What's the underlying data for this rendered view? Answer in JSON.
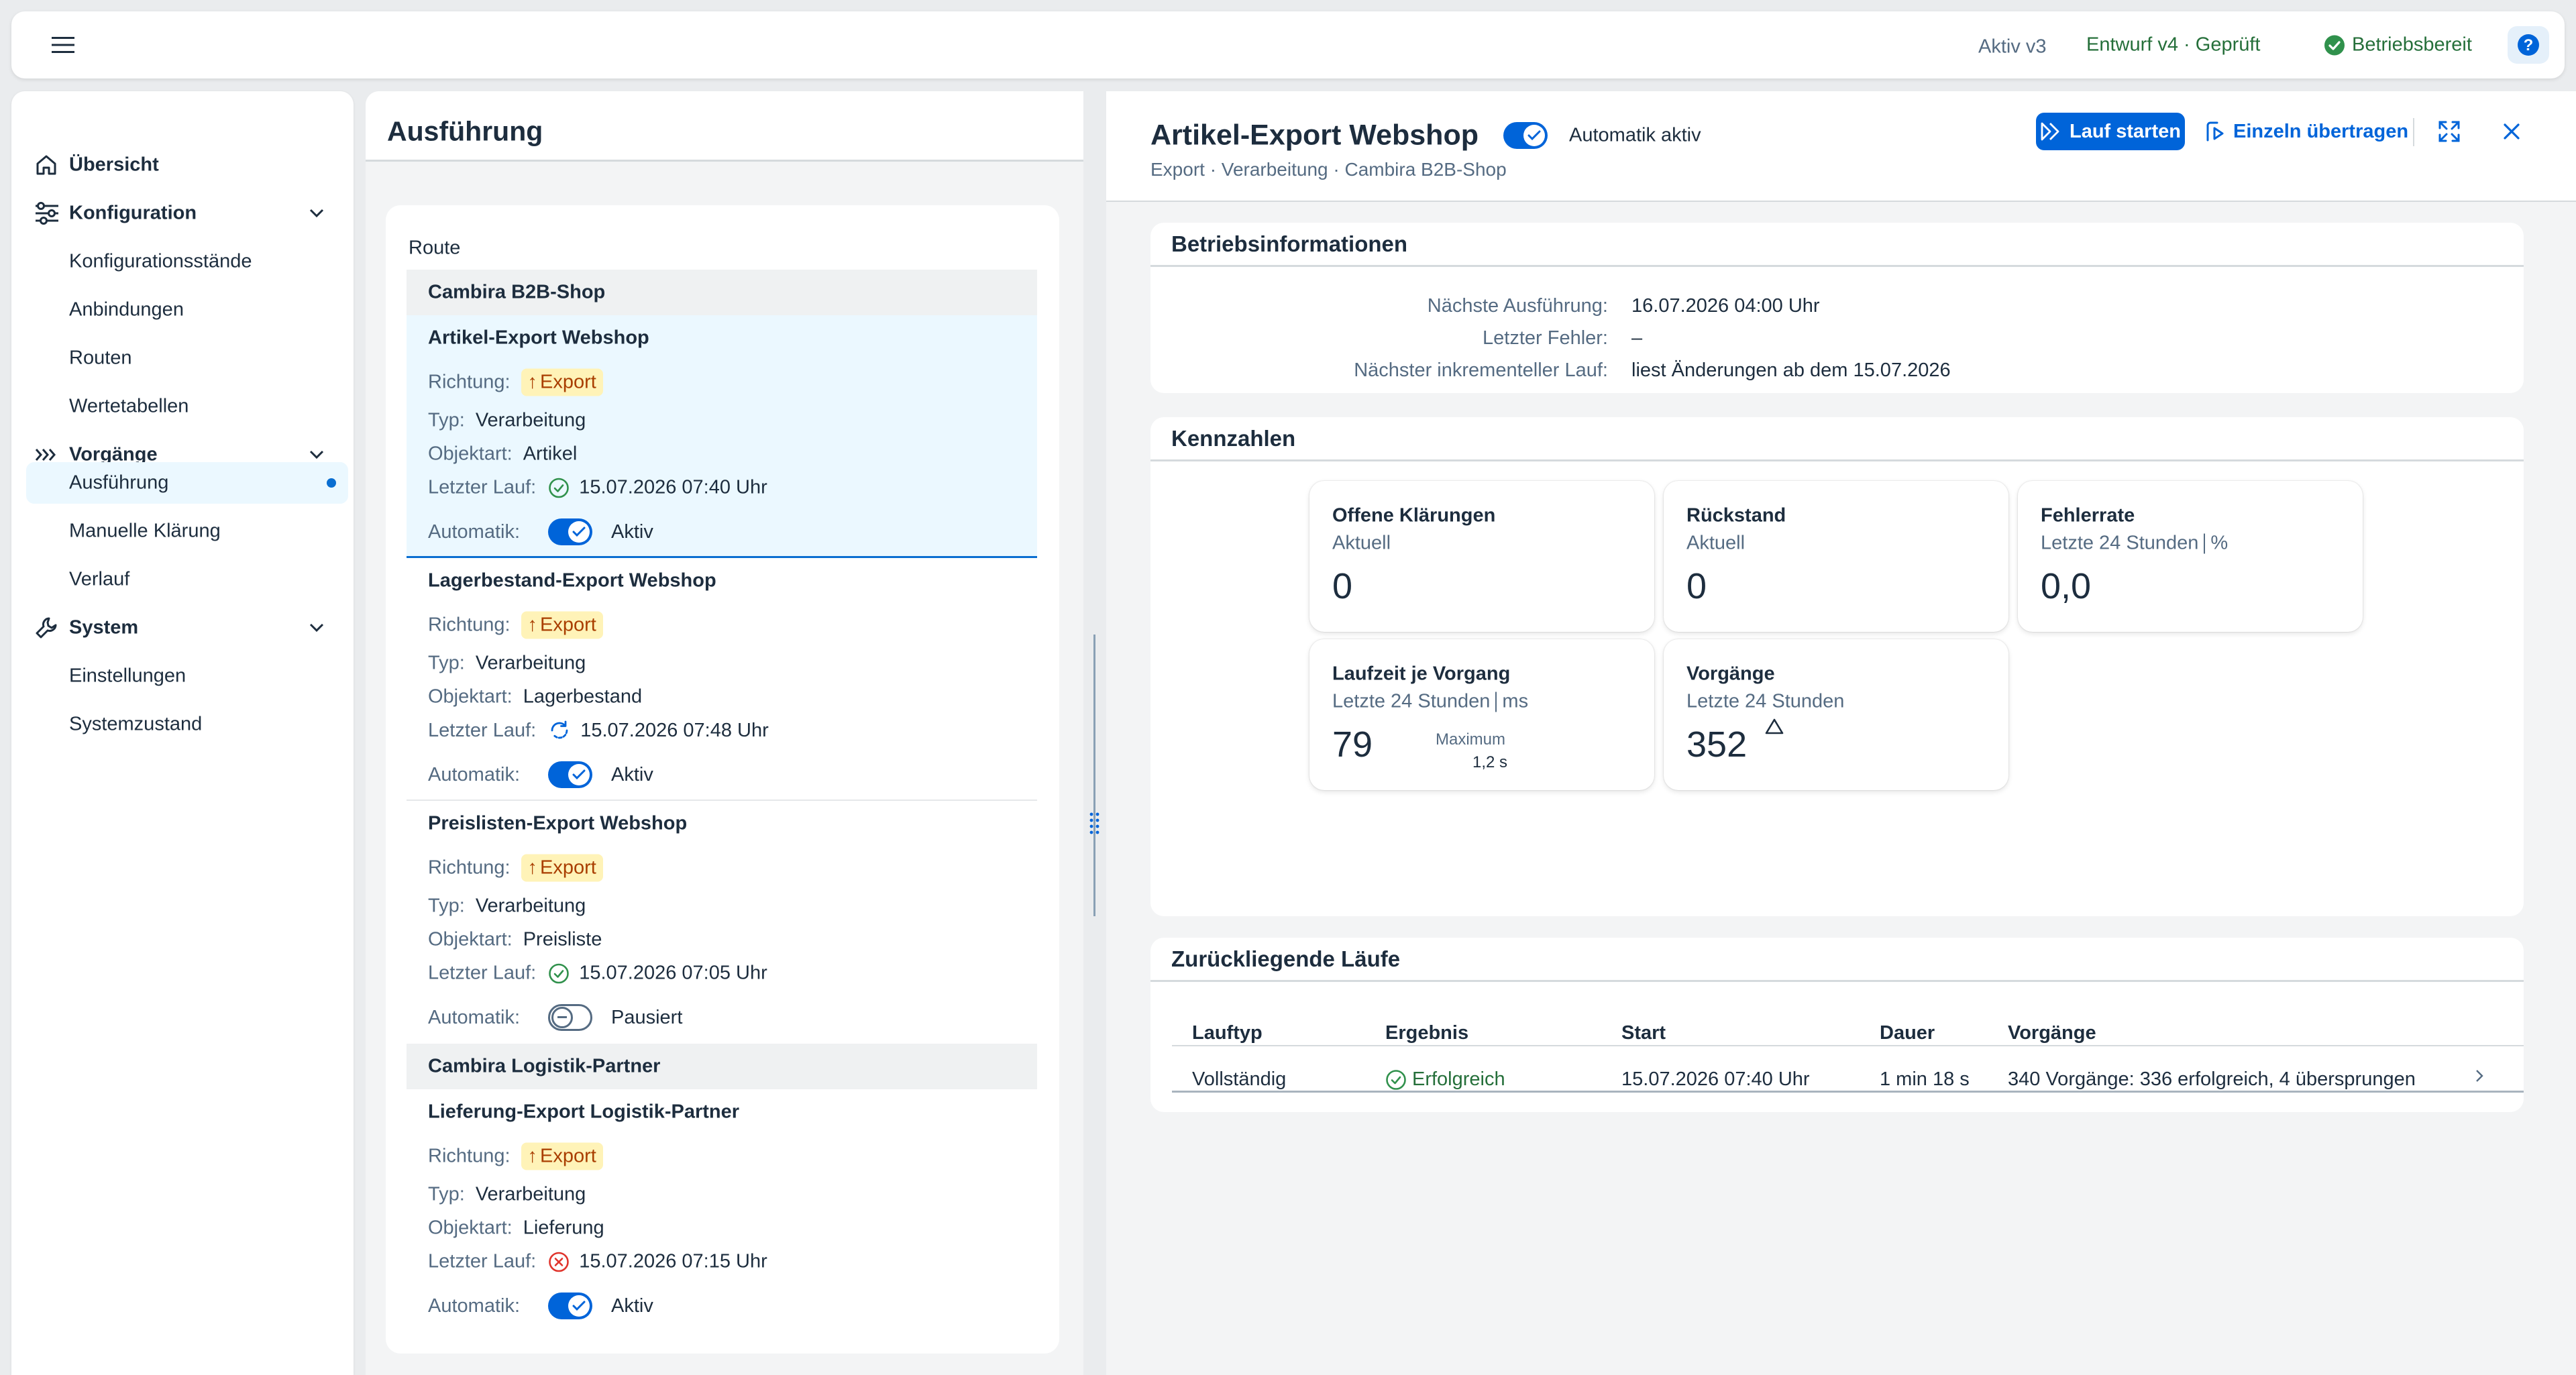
{
  "shell": {
    "active_version": "Aktiv v3",
    "draft_version": "Entwurf v4 · Geprüft",
    "status": "Betriebsbereit",
    "help": "?"
  },
  "sidebar": {
    "overview": "Übersicht",
    "groups": [
      {
        "label": "Konfiguration",
        "items": [
          "Konfigurationsstände",
          "Anbindungen",
          "Routen",
          "Wertetabellen"
        ]
      },
      {
        "label": "Vorgänge",
        "items": [
          "Ausführung",
          "Manuelle Klärung",
          "Verlauf"
        ]
      },
      {
        "label": "System",
        "items": [
          "Einstellungen",
          "Systemzustand"
        ]
      }
    ]
  },
  "middle": {
    "title": "Ausführung",
    "column_header": "Route",
    "labels": {
      "direction": "Richtung:",
      "type": "Typ:",
      "object_type": "Objektart:",
      "last_run": "Letzter Lauf:",
      "automatic": "Automatik:"
    },
    "groups": [
      "Cambira B2B-Shop",
      "Cambira Logistik-Partner"
    ],
    "routes": [
      {
        "title": "Artikel-Export Webshop",
        "direction": "Export",
        "type": "Verarbeitung",
        "object": "Artikel",
        "last_run": "15.07.2026 07:40 Uhr",
        "run_status": "success",
        "auto": "Aktiv"
      },
      {
        "title": "Lagerbestand-Export Webshop",
        "direction": "Export",
        "type": "Verarbeitung",
        "object": "Lagerbestand",
        "last_run": "15.07.2026 07:48 Uhr",
        "run_status": "running",
        "auto": "Aktiv"
      },
      {
        "title": "Preislisten-Export Webshop",
        "direction": "Export",
        "type": "Verarbeitung",
        "object": "Preisliste",
        "last_run": "15.07.2026 07:05 Uhr",
        "run_status": "success",
        "auto": "Pausiert"
      },
      {
        "title": "Lieferung-Export Logistik-Partner",
        "direction": "Export",
        "type": "Verarbeitung",
        "object": "Lieferung",
        "last_run": "15.07.2026 07:15 Uhr",
        "run_status": "error",
        "auto": "Aktiv"
      }
    ]
  },
  "detail": {
    "title": "Artikel-Export Webshop",
    "auto_label": "Automatik aktiv",
    "subtitle": "Export · Verarbeitung · Cambira B2B-Shop",
    "btn_start": "Lauf starten",
    "btn_single": "Einzeln übertragen",
    "betrieb": {
      "title": "Betriebsinformationen",
      "rows": [
        {
          "label": "Nächste Ausführung:",
          "value": "16.07.2026 04:00 Uhr"
        },
        {
          "label": "Letzter Fehler:",
          "value": "–"
        },
        {
          "label": "Nächster inkrementeller Lauf:",
          "value": "liest Änderungen ab dem 15.07.2026"
        }
      ]
    },
    "kpis": {
      "title": "Kennzahlen",
      "cards": [
        {
          "title": "Offene Klärungen",
          "sub": "Aktuell",
          "unit": "",
          "value": "0"
        },
        {
          "title": "Rückstand",
          "sub": "Aktuell",
          "unit": "",
          "value": "0"
        },
        {
          "title": "Fehlerrate",
          "sub": "Letzte 24 Stunden",
          "unit": "%",
          "value": "0,0"
        },
        {
          "title": "Laufzeit je Vorgang",
          "sub": "Letzte 24 Stunden",
          "unit": "ms",
          "value": "79",
          "extra_label": "Maximum",
          "extra_value": "1,2 s"
        },
        {
          "title": "Vorgänge",
          "sub": "Letzte 24 Stunden",
          "unit": "",
          "value": "352",
          "trend": "up"
        }
      ]
    },
    "runs": {
      "title": "Zurückliegende Läufe",
      "columns": [
        "Lauftyp",
        "Ergebnis",
        "Start",
        "Dauer",
        "Vorgänge"
      ],
      "rows": [
        {
          "type": "Vollständig",
          "result": "Erfolgreich",
          "start": "15.07.2026 07:40 Uhr",
          "duration": "1 min 18 s",
          "count": "340 Vorgänge: 336 erfolgreich, 4 übersprungen"
        }
      ]
    }
  },
  "colors": {
    "accent": "#0064d9",
    "success": "#256f3a",
    "warning_bg": "#fff3b8",
    "warning_fg": "#a93e00",
    "error": "#e0342c"
  }
}
